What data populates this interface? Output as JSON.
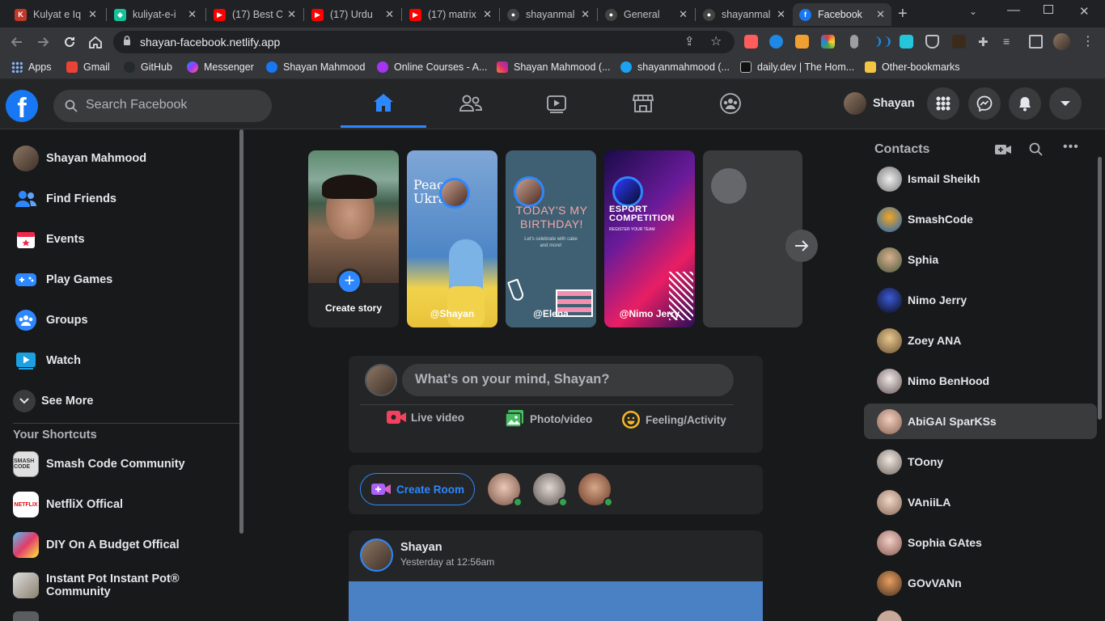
{
  "browser": {
    "tabs": [
      {
        "title": "Kulyat e Iq",
        "icon": "book-icon",
        "color": "#c0392b"
      },
      {
        "title": "kuliyat-e-i",
        "icon": "netlify-icon",
        "color": "#15c39a"
      },
      {
        "title": "(17) Best C",
        "icon": "youtube-icon",
        "color": "#ff0000"
      },
      {
        "title": "(17) Urdu",
        "icon": "youtube-icon",
        "color": "#ff0000"
      },
      {
        "title": "(17) matrix",
        "icon": "youtube-icon",
        "color": "#ff0000"
      },
      {
        "title": "shayanmal",
        "icon": "github-icon",
        "color": "#333"
      },
      {
        "title": "General",
        "icon": "github-icon",
        "color": "#333"
      },
      {
        "title": "shayanmal",
        "icon": "github-icon",
        "color": "#333"
      },
      {
        "title": "Facebook",
        "icon": "facebook-icon",
        "color": "#1877f2"
      }
    ],
    "url": "shayan-facebook.netlify.app",
    "bookmarks": [
      {
        "label": "Apps",
        "icon": "apps-grid-icon",
        "color": "#8ab4f8"
      },
      {
        "label": "Gmail",
        "icon": "gmail-icon",
        "color": "#ea4335"
      },
      {
        "label": "GitHub",
        "icon": "github-icon",
        "color": "#24292e"
      },
      {
        "label": "Messenger",
        "icon": "messenger-icon",
        "color": "#a33bff"
      },
      {
        "label": "Shayan Mahmood",
        "icon": "facebook-icon",
        "color": "#1877f2"
      },
      {
        "label": "Online Courses - A...",
        "icon": "udemy-icon",
        "color": "#a435f0"
      },
      {
        "label": "Shayan Mahmood (...",
        "icon": "instagram-icon",
        "color": "#e1306c"
      },
      {
        "label": "shayanmahmood (...",
        "icon": "twitter-icon",
        "color": "#1da1f2"
      },
      {
        "label": "daily.dev | The Hom...",
        "icon": "dailydev-icon",
        "color": "#111"
      },
      {
        "label": "Other-bookmarks",
        "icon": "folder-icon",
        "color": "#f4c542"
      }
    ]
  },
  "header": {
    "search_placeholder": "Search Facebook",
    "user_name": "Shayan",
    "nav": [
      "home-icon",
      "friends-icon",
      "watch-icon",
      "marketplace-icon",
      "groups-icon"
    ]
  },
  "left_sidebar": {
    "profile_name": "Shayan Mahmood",
    "items": [
      {
        "label": "Find Friends",
        "icon": "friends-icon",
        "color": "#2d88ff"
      },
      {
        "label": "Events",
        "icon": "calendar-icon",
        "color": "#f02849"
      },
      {
        "label": "Play Games",
        "icon": "gamepad-icon",
        "color": "#2d88ff"
      },
      {
        "label": "Groups",
        "icon": "groups-icon",
        "color": "#2d88ff"
      },
      {
        "label": "Watch",
        "icon": "watch-icon",
        "color": "#1ba0e2"
      }
    ],
    "see_more": "See More",
    "shortcuts_heading": "Your Shortcuts",
    "shortcuts": [
      {
        "label": "Smash Code Community",
        "color": "#e0e0e0"
      },
      {
        "label": "NetfliX Offical",
        "color": "#ffffff"
      },
      {
        "label": "DIY On A Budget Offical",
        "color": "#e23b6b"
      },
      {
        "label": "Instant Pot Instant Pot® Community",
        "color": "#b8b0a0"
      }
    ]
  },
  "stories": {
    "create_label": "Create story",
    "items": [
      {
        "name": "@Shayan",
        "text": "Peace Ukra"
      },
      {
        "name": "@Elena",
        "text": "TODAY'S MY BIRTHDAY!",
        "sub": "Let's celebrate with cake and more!"
      },
      {
        "name": "@Nimo Jerry",
        "text": "ESPORT COMPETITION",
        "sub": "REGISTER YOUR TEAM"
      }
    ]
  },
  "composer": {
    "placeholder": "What's on your mind, Shayan?",
    "actions": [
      {
        "label": "Live video",
        "icon": "live-video-icon",
        "color": "#f3425f"
      },
      {
        "label": "Photo/video",
        "icon": "photo-icon",
        "color": "#45bd62"
      },
      {
        "label": "Feeling/Activity",
        "icon": "smile-icon",
        "color": "#f7b928"
      }
    ]
  },
  "room": {
    "create_label": "Create Room"
  },
  "post": {
    "author": "Shayan",
    "time": "Yesterday at 12:56am"
  },
  "contacts": {
    "heading": "Contacts",
    "list": [
      {
        "name": "Ismail Sheikh",
        "color": "#d0d0d0"
      },
      {
        "name": "SmashCode",
        "color": "#f5a623"
      },
      {
        "name": "Sphia",
        "color": "#7a6a4f"
      },
      {
        "name": "Nimo Jerry",
        "color": "#1b2a5a"
      },
      {
        "name": "Zoey ANA",
        "color": "#b89a6a"
      },
      {
        "name": "Nimo BenHood",
        "color": "#c8c0c0"
      },
      {
        "name": "AbiGAl SparKSs",
        "color": "#d8b8a8"
      },
      {
        "name": "TOony",
        "color": "#e0d8d0"
      },
      {
        "name": "VAniiLA",
        "color": "#d8c0b0"
      },
      {
        "name": "Sophia GAtes",
        "color": "#d8b0a8"
      },
      {
        "name": "GOvVANn",
        "color": "#c87840"
      }
    ]
  },
  "colors": {
    "accent": "#2d88ff",
    "bg": "#18191a",
    "card": "#242526",
    "online": "#31a24c"
  }
}
